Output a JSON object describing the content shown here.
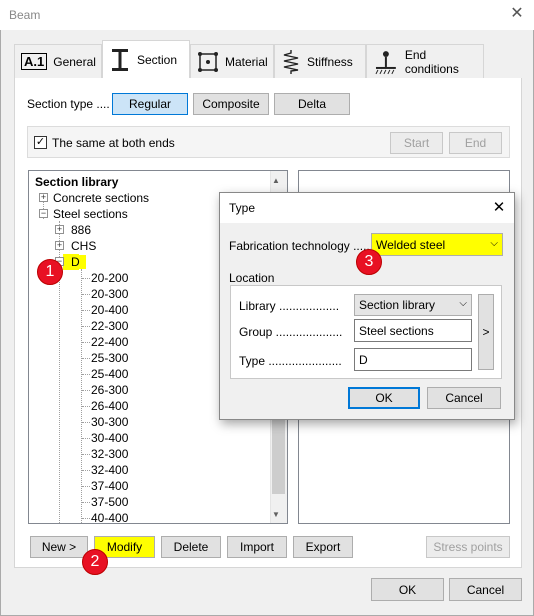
{
  "window": {
    "title": "Beam",
    "close_glyph": "✕"
  },
  "tabs": [
    {
      "label": "General",
      "icon": "a1-icon",
      "icon_text": "A.1"
    },
    {
      "label": "Section",
      "icon": "i-beam-icon"
    },
    {
      "label": "Material",
      "icon": "material-icon"
    },
    {
      "label": "Stiffness",
      "icon": "spring-icon"
    },
    {
      "label": "End conditions",
      "icon": "support-icon"
    }
  ],
  "section_type": {
    "label": "Section type ....",
    "options": [
      "Regular",
      "Composite",
      "Delta"
    ],
    "selected": "Regular"
  },
  "same_both_ends": {
    "label": "The same at both ends",
    "checked": true,
    "check_glyph": "✓"
  },
  "end_buttons": {
    "start": "Start",
    "end": "End"
  },
  "tree": {
    "header": "Section library",
    "items": [
      {
        "label": "Concrete sections",
        "expander": "+"
      },
      {
        "label": "Steel sections",
        "expander": "−"
      },
      {
        "label": "886",
        "expander": "+"
      },
      {
        "label": "CHS",
        "expander": "+"
      },
      {
        "label": "D",
        "expander": "−"
      }
    ],
    "leaves": [
      "20-200",
      "20-300",
      "20-400",
      "22-300",
      "22-400",
      "25-300",
      "25-400",
      "26-300",
      "26-400",
      "30-300",
      "30-400",
      "32-300",
      "32-400",
      "37-400",
      "37-500",
      "40-400"
    ]
  },
  "bottom_buttons": {
    "new": "New >",
    "modify": "Modify",
    "delete": "Delete",
    "import": "Import",
    "export": "Export",
    "stress_points": "Stress points"
  },
  "dialog_buttons": {
    "ok": "OK",
    "cancel": "Cancel"
  },
  "type_dialog": {
    "title": "Type",
    "close_glyph": "✕",
    "fabrication_label": "Fabrication technology ......",
    "fabrication_value": "Welded steel",
    "location_label": "Location",
    "library_label": "Library ..................",
    "library_value": "Section library",
    "group_label": "Group ....................",
    "group_value": "Steel sections",
    "type_label": "Type ......................",
    "type_value": "D",
    "side_button": ">",
    "ok": "OK",
    "cancel": "Cancel"
  },
  "annotations": [
    "1",
    "2",
    "3"
  ],
  "colors": {
    "highlight": "#ffff00",
    "badge": "#e81123",
    "accent": "#0078d7"
  }
}
